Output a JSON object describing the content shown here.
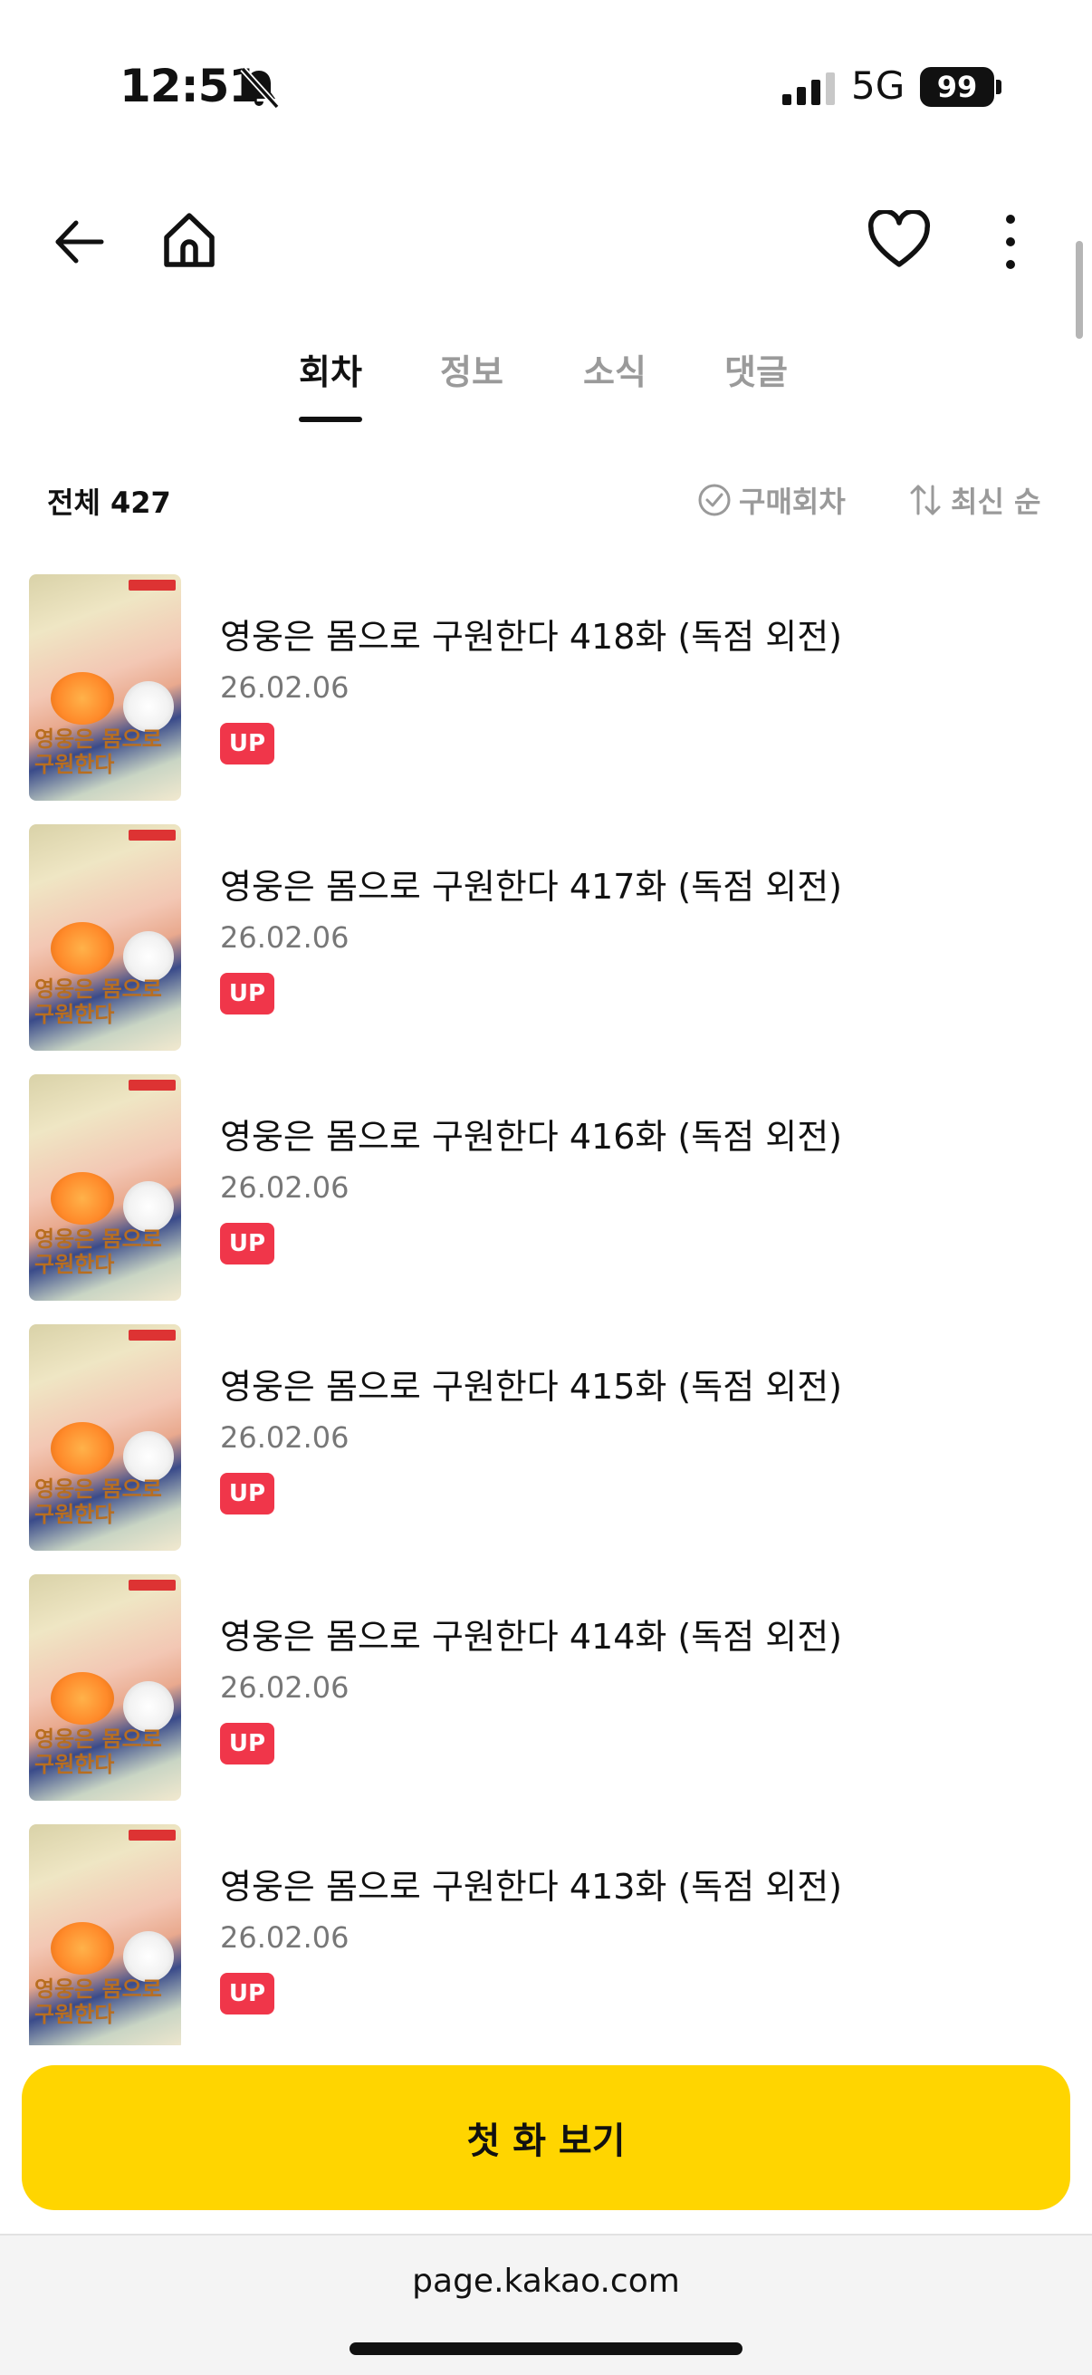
{
  "status_bar": {
    "time": "12:51",
    "network": "5G",
    "battery": "99"
  },
  "tabs": [
    {
      "label": "회차",
      "active": true
    },
    {
      "label": "정보",
      "active": false
    },
    {
      "label": "소식",
      "active": false
    },
    {
      "label": "댓글",
      "active": false
    }
  ],
  "list_header": {
    "total_label": "전체 427",
    "filter_label": "구매회차",
    "sort_label": "최신 순"
  },
  "episodes": [
    {
      "title": "영웅은 몸으로 구원한다 418화 (독점 외전)",
      "date": "26.02.06",
      "badge": "UP"
    },
    {
      "title": "영웅은 몸으로 구원한다 417화 (독점 외전)",
      "date": "26.02.06",
      "badge": "UP"
    },
    {
      "title": "영웅은 몸으로 구원한다 416화 (독점 외전)",
      "date": "26.02.06",
      "badge": "UP"
    },
    {
      "title": "영웅은 몸으로 구원한다 415화 (독점 외전)",
      "date": "26.02.06",
      "badge": "UP"
    },
    {
      "title": "영웅은 몸으로 구원한다 414화 (독점 외전)",
      "date": "26.02.06",
      "badge": "UP"
    },
    {
      "title": "영웅은 몸으로 구원한다 413화 (독점 외전)",
      "date": "26.02.06",
      "badge": "UP"
    }
  ],
  "thumbnail_logo": "영웅은 몸으로 구원한다",
  "cta": {
    "label": "첫 화 보기"
  },
  "browser": {
    "url": "page.kakao.com"
  },
  "colors": {
    "accent": "#ffd500",
    "badge": "#f0364a",
    "muted": "#9a9a9a"
  },
  "icons": [
    "bell-slash-icon",
    "signal-icon",
    "back-arrow-icon",
    "home-icon",
    "heart-icon",
    "more-vertical-icon",
    "check-circle-icon",
    "sort-arrows-icon"
  ]
}
